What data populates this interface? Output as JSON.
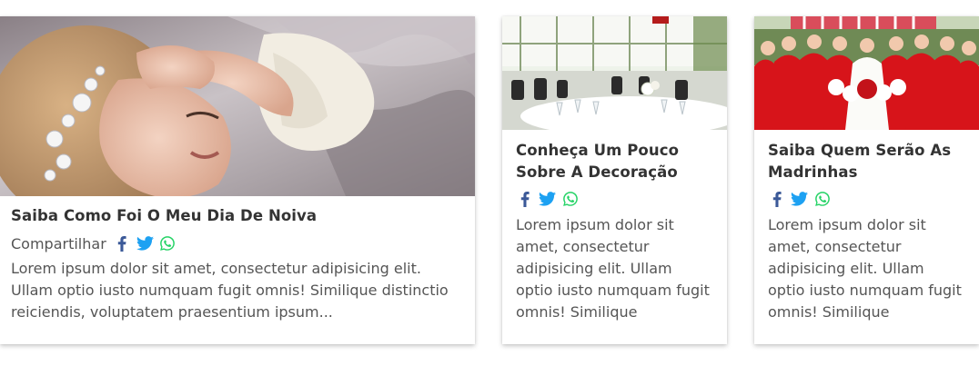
{
  "posts": [
    {
      "title": "Saiba Como Foi O Meu Dia De Noiva",
      "share_label": "Compartilhar",
      "excerpt": "Lorem ipsum dolor sit amet, consectetur adipisicing elit. Ullam optio iusto numquam fugit omnis! Similique distinctio reiciendis, voluptatem praesentium ipsum...",
      "image_icon": "bride-photo"
    },
    {
      "title": "Conheça Um Pouco Sobre A Decoração",
      "excerpt": "Lorem ipsum dolor sit amet, consectetur adipisicing elit. Ullam optio iusto numquam fugit omnis! Similique",
      "image_icon": "reception-hall-photo"
    },
    {
      "title": "Saiba Quem Serão As Madrinhas",
      "excerpt": "Lorem ipsum dolor sit amet, consectetur adipisicing elit. Ullam optio iusto numquam fugit omnis! Similique",
      "image_icon": "bridesmaids-photo"
    }
  ],
  "social": {
    "facebook": {
      "icon": "facebook-icon",
      "color": "#3b5998"
    },
    "twitter": {
      "icon": "twitter-icon",
      "color": "#1da1f2"
    },
    "whatsapp": {
      "icon": "whatsapp-icon",
      "color": "#25d366"
    }
  },
  "colors": {
    "title": "#333333",
    "text": "#555555",
    "card_bg": "#ffffff"
  }
}
